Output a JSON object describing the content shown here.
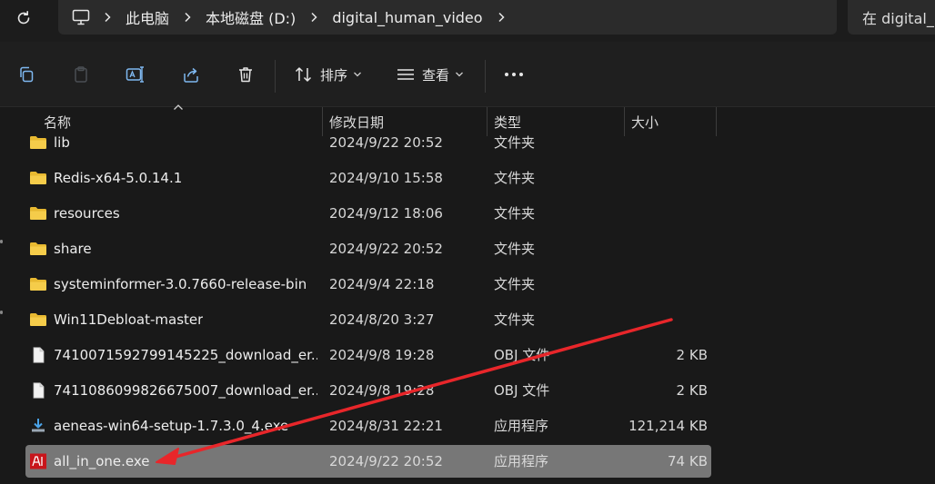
{
  "address_bar": {
    "breadcrumbs": [
      "此电脑",
      "本地磁盘 (D:)",
      "digital_human_video"
    ],
    "search_placeholder": "在 digital_"
  },
  "toolbar": {
    "sort_label": "排序",
    "view_label": "查看"
  },
  "columns": {
    "name": "名称",
    "modified": "修改日期",
    "type": "类型",
    "size": "大小"
  },
  "files": [
    {
      "name": "lib",
      "date": "2024/9/22 20:52",
      "type": "文件夹",
      "size": "",
      "icon": "folder-icon"
    },
    {
      "name": "Redis-x64-5.0.14.1",
      "date": "2024/9/10 15:58",
      "type": "文件夹",
      "size": "",
      "icon": "folder-icon"
    },
    {
      "name": "resources",
      "date": "2024/9/12 18:06",
      "type": "文件夹",
      "size": "",
      "icon": "folder-icon"
    },
    {
      "name": "share",
      "date": "2024/9/22 20:52",
      "type": "文件夹",
      "size": "",
      "icon": "folder-icon"
    },
    {
      "name": "systeminformer-3.0.7660-release-bin",
      "date": "2024/9/4 22:18",
      "type": "文件夹",
      "size": "",
      "icon": "folder-icon"
    },
    {
      "name": "Win11Debloat-master",
      "date": "2024/8/20 3:27",
      "type": "文件夹",
      "size": "",
      "icon": "folder-icon"
    },
    {
      "name": "7410071592799145225_download_er...",
      "date": "2024/9/8 19:28",
      "type": "OBJ 文件",
      "size": "2 KB",
      "icon": "document-icon"
    },
    {
      "name": "7411086099826675007_download_er...",
      "date": "2024/9/8 19:28",
      "type": "OBJ 文件",
      "size": "2 KB",
      "icon": "document-icon"
    },
    {
      "name": "aeneas-win64-setup-1.7.3.0_4.exe",
      "date": "2024/8/31 22:21",
      "type": "应用程序",
      "size": "121,214 KB",
      "icon": "installer-icon"
    },
    {
      "name": "all_in_one.exe",
      "date": "2024/9/22 20:52",
      "type": "应用程序",
      "size": "74 KB",
      "icon": "app-exe-icon"
    }
  ],
  "selected_file": "all_in_one.exe",
  "colors": {
    "folder": "#e8b931",
    "selection": "#777777",
    "annotation_arrow": "#e8262a"
  }
}
